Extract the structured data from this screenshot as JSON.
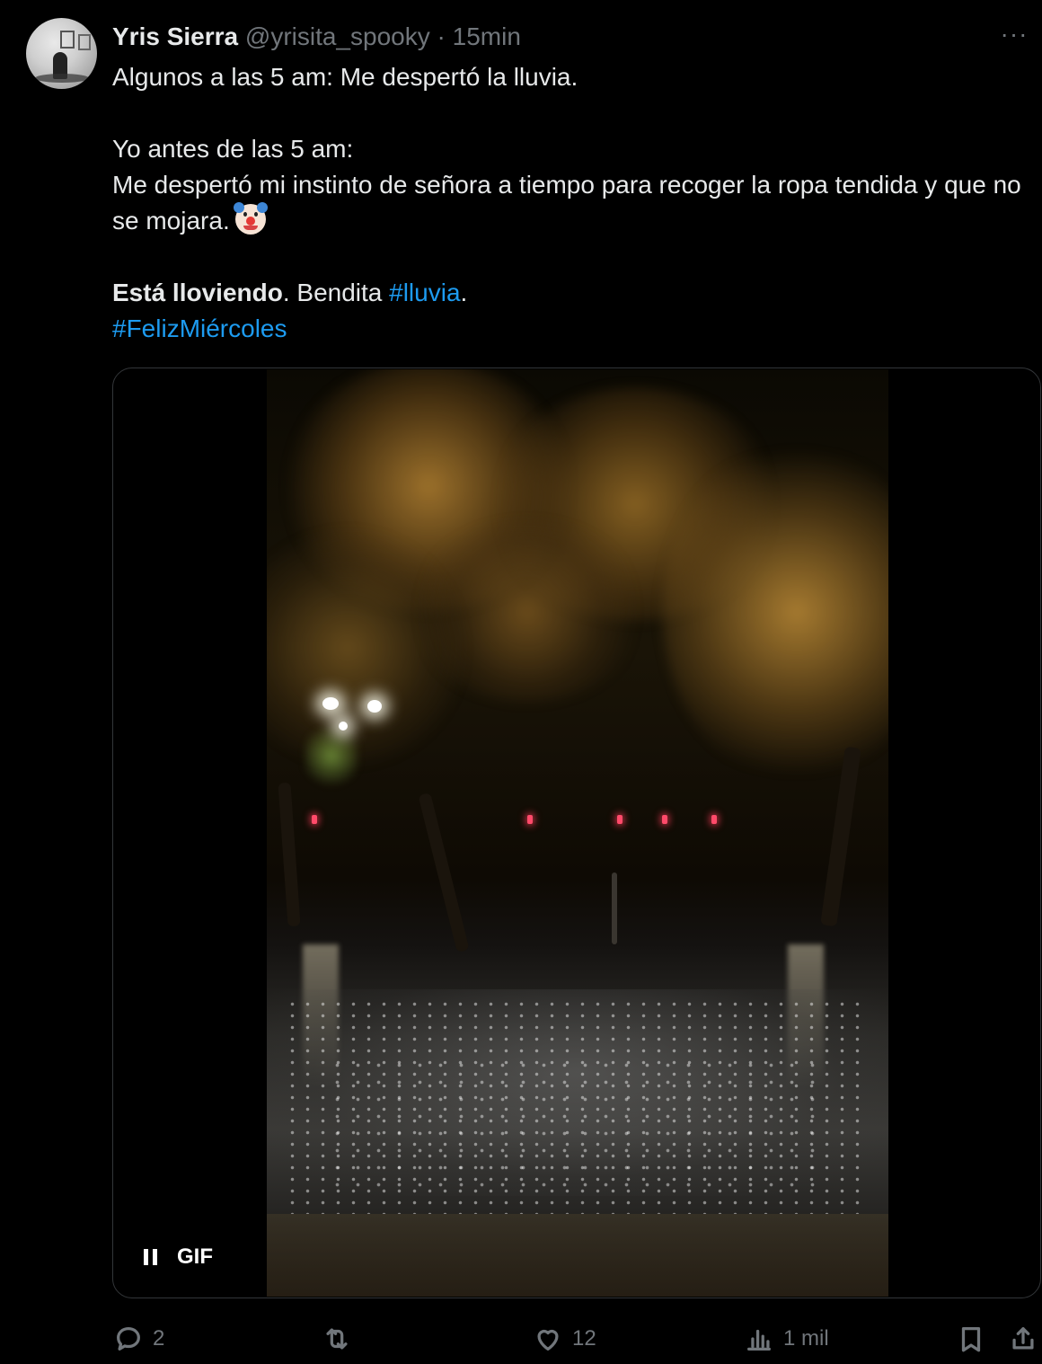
{
  "tweet": {
    "author_name": "Yris Sierra",
    "handle": "@yrisita_spooky",
    "separator": " · ",
    "time": "15min",
    "more_label": "···",
    "line1": "Algunos a las 5 am: Me despertó la lluvia.",
    "line2": "Yo antes de las 5 am:",
    "line3": "Me despertó mi instinto de señora a tiempo para recoger la ropa tendida y que no se mojara.",
    "emoji_icon": "clown-face-emoji",
    "line4_bold": "Está lloviendo",
    "line4_rest": ". Bendita ",
    "hashtag1": "#lluvia",
    "line4_end": ".",
    "hashtag2": "#FelizMiércoles"
  },
  "media": {
    "type": "gif",
    "badge_label": "GIF",
    "control_icon": "pause-icon"
  },
  "actions": {
    "replies": "2",
    "reposts": "",
    "likes": "12",
    "views": "1 mil"
  },
  "colors": {
    "background": "#000000",
    "text": "#e7e9ea",
    "muted": "#71767b",
    "link": "#1d9bf0"
  }
}
